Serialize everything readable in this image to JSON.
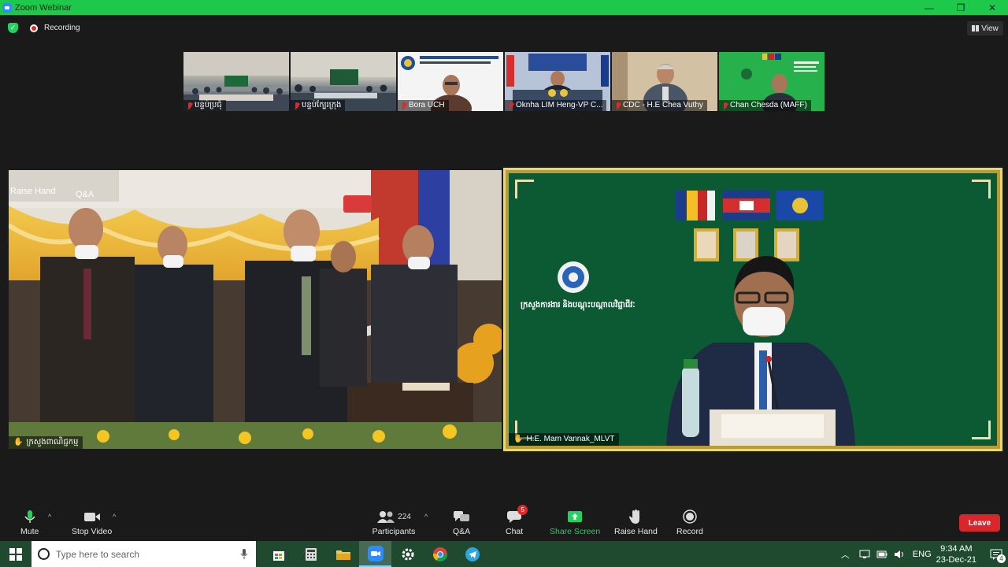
{
  "window": {
    "title": "Zoom Webinar",
    "minimize_glyph": "—",
    "maximize_glyph": "❐",
    "close_glyph": "✕"
  },
  "meeting_bar": {
    "recording_label": "Recording",
    "view_label": "View"
  },
  "thumbnails": [
    {
      "name": "បន្ទប់ប្រជុំ",
      "muted": true,
      "icon": "mic-off-icon"
    },
    {
      "name": "បន្ទប់ក្បែរក្រុង",
      "muted": true,
      "icon": "mic-off-icon"
    },
    {
      "name": "Bora UCH",
      "muted": true,
      "icon": "mic-off-icon",
      "banner": "Ministry of Industry, Science, Technology & Innovation"
    },
    {
      "name": "Oknha LIM Heng-VP C...",
      "muted": true,
      "icon": "mic-off-icon",
      "banner": "CAMBODIA CHAMBER OF COMMERCE"
    },
    {
      "name": "CDC - H.E Chea Vuthy",
      "muted": true,
      "icon": "mic-off-icon"
    },
    {
      "name": "Chan Chesda (MAFF)",
      "muted": true,
      "icon": "mic-off-icon"
    }
  ],
  "main_video": {
    "name": "ក្រសួងពាណិជ្ជកម្ម",
    "overlay_raise_hand": "Raise Hand",
    "overlay_qa": "Q&A"
  },
  "active_speaker": {
    "name": "H.E. Mam Vannak_MLVT",
    "ministry_caption": "ក្រសួងការងារ និងបណ្តុះបណ្តាលវិជ្ជាជីវៈ"
  },
  "toolbar": {
    "mute_label": "Mute",
    "stop_video_label": "Stop Video",
    "participants_label": "Participants",
    "participants_count": "224",
    "qa_label": "Q&A",
    "chat_label": "Chat",
    "chat_badge": "5",
    "share_screen_label": "Share Screen",
    "raise_hand_label": "Raise Hand",
    "record_label": "Record",
    "leave_label": "Leave",
    "caret": "^"
  },
  "colors": {
    "titlebar_green": "#1ec84a",
    "share_green": "#23d160",
    "leave_red": "#d9262b",
    "speaker_bg": "#0a5c35"
  },
  "taskbar": {
    "search_placeholder": "Type here to search",
    "language": "ENG",
    "time": "9:34 AM",
    "date": "23-Dec-21",
    "notification_count": "4",
    "apps": [
      "store-icon",
      "calculator-icon",
      "file-explorer-icon",
      "zoom-icon",
      "settings-icon",
      "chrome-icon",
      "telegram-icon"
    ]
  }
}
